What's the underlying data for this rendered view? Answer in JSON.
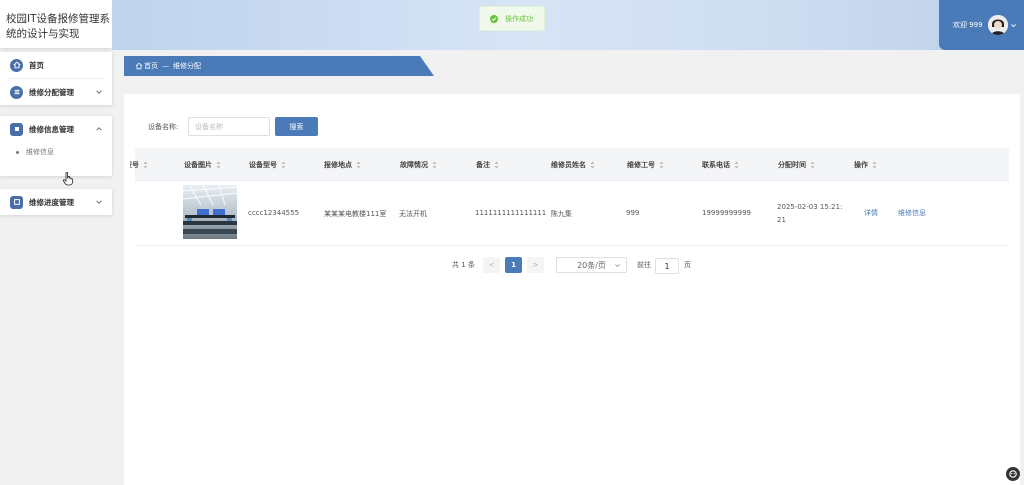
{
  "app": {
    "title": "校园IT设备报修管理系统的设计与实现"
  },
  "sidebar": {
    "items": [
      {
        "label": "首页"
      },
      {
        "label": "维修分配管理"
      },
      {
        "label": "维修信息管理",
        "children": [
          {
            "label": "维修信息"
          }
        ]
      },
      {
        "label": "维修进度管理"
      }
    ]
  },
  "header": {
    "toast": "操作成功",
    "welcome": "欢迎 999"
  },
  "breadcrumb": {
    "home": "首页",
    "separator": "—",
    "current": "维修分配"
  },
  "search": {
    "label": "设备名称:",
    "placeholder": "设备名称",
    "value": "",
    "button": "搜索"
  },
  "table": {
    "columns": [
      "型号",
      "设备图片",
      "设备型号",
      "报修地点",
      "故障情况",
      "备注",
      "维修员姓名",
      "维修工号",
      "联系电话",
      "分配时间",
      "操作"
    ],
    "rows": [
      {
        "model": "cccc12344555",
        "location": "某某某电教楼111室",
        "fault": "无法开机",
        "note": "1111111111111111",
        "repairer": "陈九集",
        "worker_id": "999",
        "phone": "19999999999",
        "time_line1": "2025-02-03 15:21:",
        "time_line2": "21",
        "action_detail": "详情",
        "action_repair": "维修信息"
      }
    ]
  },
  "pagination": {
    "total": "共 1 条",
    "prev": "<",
    "current_page": "1",
    "next": ">",
    "page_size": "20条/页",
    "goto_label": "前往",
    "goto_value": "1",
    "page_suffix": "页"
  },
  "colors": {
    "primary": "#4a7ab8",
    "success": "#67c23a"
  }
}
